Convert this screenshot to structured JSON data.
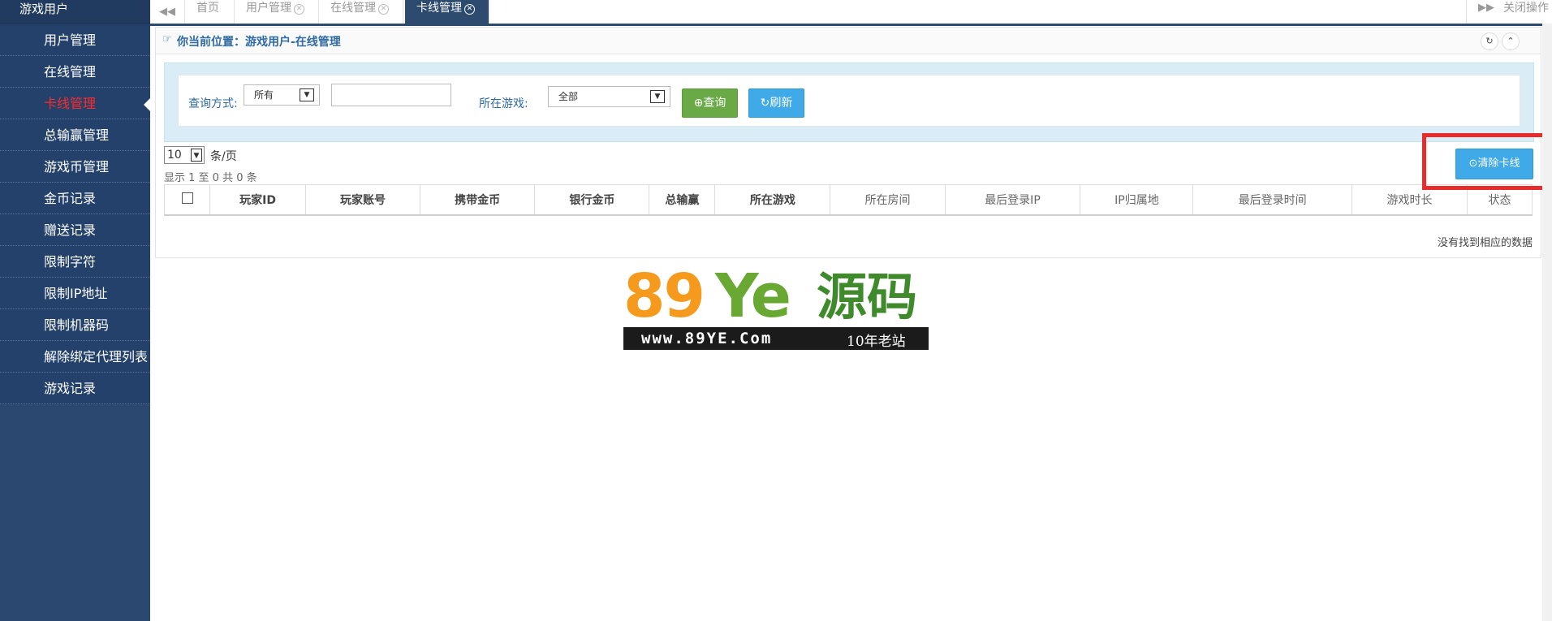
{
  "sidebar": {
    "header": "游戏用户",
    "items": [
      {
        "label": "用户管理",
        "active": false
      },
      {
        "label": "在线管理",
        "active": false
      },
      {
        "label": "卡线管理",
        "active": true
      },
      {
        "label": "总输赢管理",
        "active": false
      },
      {
        "label": "游戏币管理",
        "active": false
      },
      {
        "label": "金币记录",
        "active": false
      },
      {
        "label": "赠送记录",
        "active": false
      },
      {
        "label": "限制字符",
        "active": false
      },
      {
        "label": "限制IP地址",
        "active": false
      },
      {
        "label": "限制机器码",
        "active": false
      },
      {
        "label": "解除绑定代理列表",
        "active": false
      },
      {
        "label": "游戏记录",
        "active": false
      }
    ]
  },
  "tabs": {
    "back_icon": "double-chevron-left-icon",
    "forward_icon": "double-chevron-right-icon",
    "items": [
      "首页",
      "用户管理",
      "在线管理",
      "卡线管理"
    ],
    "close_symbol": "✕",
    "close_ops": "关闭操作"
  },
  "breadcrumb": {
    "icon": "hand-point-icon",
    "text": "你当前位置：游戏用户-在线管理",
    "refresh_icon": "↻",
    "collapse_icon": "⌃"
  },
  "search": {
    "mode_label": "查询方式:",
    "mode_value": "所有",
    "keyword_value": "",
    "game_label": "所在游戏:",
    "game_value": "全部",
    "query_button": "查询",
    "refresh_button": "刷新",
    "select_arrow": "▼"
  },
  "pagination": {
    "page_size": "10",
    "page_size_suffix": "条/页",
    "info": "显示 1 至 0 共 0 条"
  },
  "actions": {
    "clear_button": "清除卡线"
  },
  "table": {
    "columns": [
      "玩家ID",
      "玩家账号",
      "携带金币",
      "银行金币",
      "总输赢",
      "所在游戏",
      "所在房间",
      "最后登录IP",
      "IP归属地",
      "最后登录时间",
      "游戏时长",
      "状态"
    ],
    "empty_text": "没有找到相应的数据"
  },
  "watermark": {
    "logo_num": "89",
    "logo_ye": "Ye",
    "logo_cn": "源码",
    "url": "www.89YE.Com",
    "slogan": "10年老站"
  },
  "colors": {
    "sidebar_bg": "#23416a",
    "active_item": "#ff2a2a",
    "tab_active": "#2d4a6f",
    "query_green": "#69aa46",
    "refresh_blue": "#40a9e8",
    "highlight_red": "#e82b2b"
  }
}
